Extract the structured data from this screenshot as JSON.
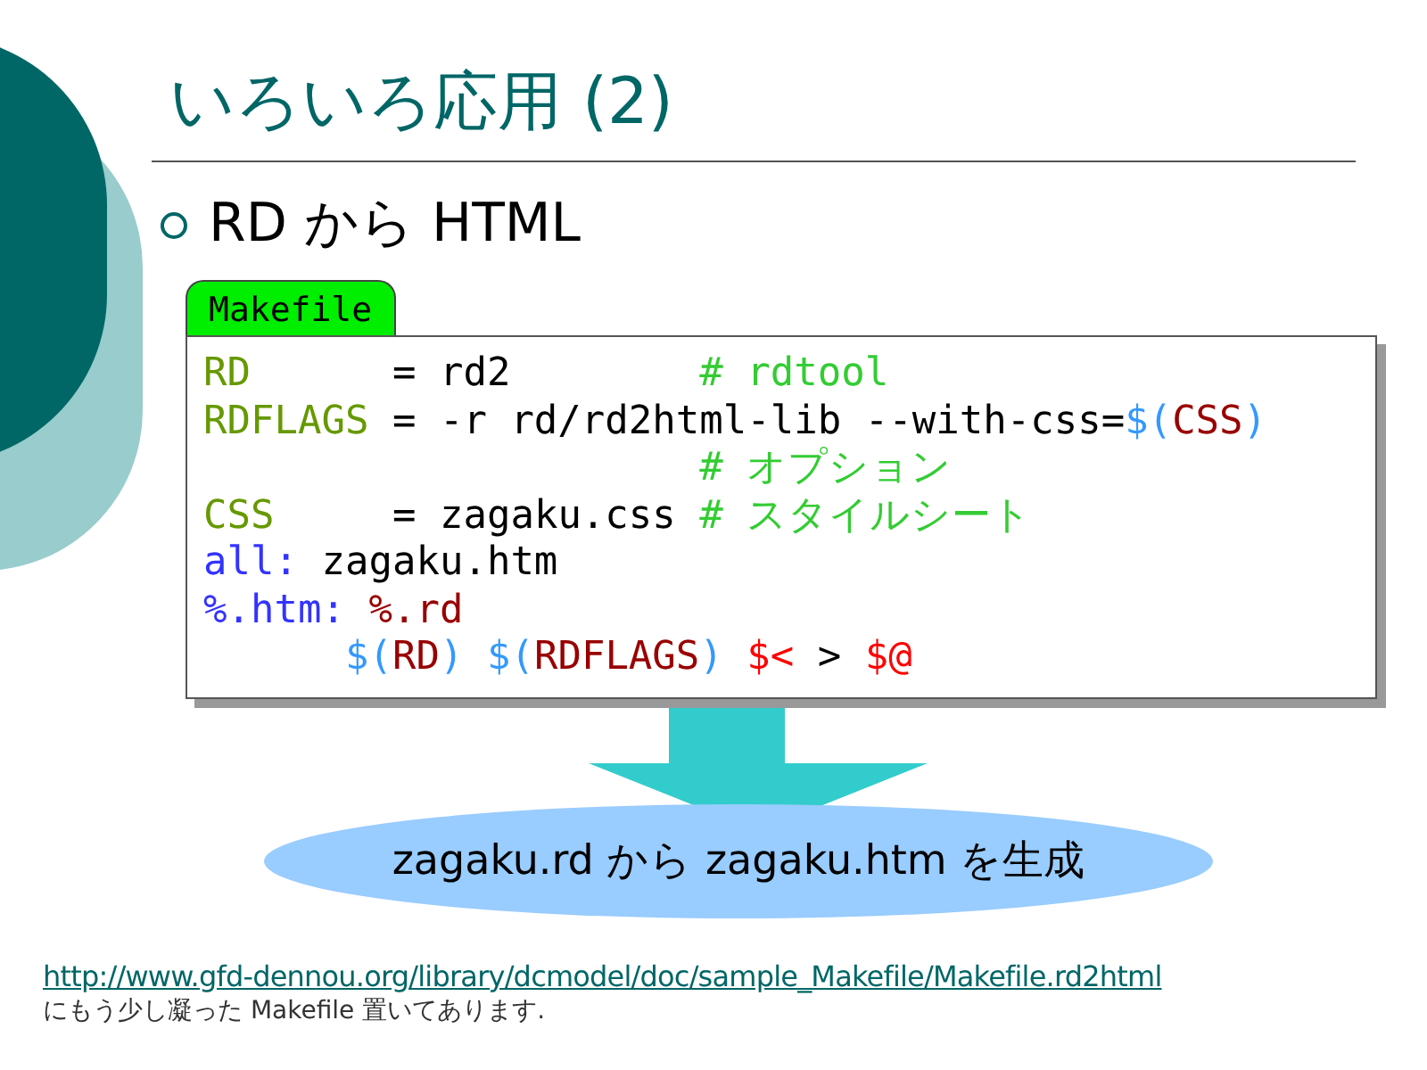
{
  "title": "いろいろ応用 (2)",
  "bullet": "RD から HTML",
  "code_tab": "Makefile",
  "code_lines": [
    [
      {
        "kind": "var",
        "text": "RD"
      },
      {
        "kind": "plain",
        "text": "      = rd2        "
      },
      {
        "kind": "comment",
        "text": "# rdtool"
      }
    ],
    [
      {
        "kind": "var",
        "text": "RDFLAGS"
      },
      {
        "kind": "plain",
        "text": " = -r rd/rd2html-lib --with-css="
      },
      {
        "kind": "dollar",
        "text": "$("
      },
      {
        "kind": "name",
        "text": "CSS"
      },
      {
        "kind": "dollar",
        "text": ")"
      }
    ],
    [
      {
        "kind": "comment",
        "text": "                     # オプション"
      }
    ],
    [
      {
        "kind": "var",
        "text": "CSS"
      },
      {
        "kind": "plain",
        "text": "     = zagaku.css "
      },
      {
        "kind": "comment",
        "text": "# スタイルシート"
      }
    ],
    [
      {
        "kind": "target",
        "text": "all:"
      },
      {
        "kind": "plain",
        "text": " zagaku.htm"
      }
    ],
    [
      {
        "kind": "target",
        "text": "%.htm: "
      },
      {
        "kind": "name",
        "text": "%.rd"
      }
    ],
    [
      {
        "kind": "dollar",
        "text": "      $("
      },
      {
        "kind": "name",
        "text": "RD"
      },
      {
        "kind": "dollar",
        "text": ") $("
      },
      {
        "kind": "name",
        "text": "RDFLAGS"
      },
      {
        "kind": "dollar",
        "text": ") "
      },
      {
        "kind": "special",
        "text": "$<"
      },
      {
        "kind": "plain",
        "text": " > "
      },
      {
        "kind": "special",
        "text": "$@"
      }
    ]
  ],
  "result": "zagaku.rd から zagaku.htm を生成",
  "link": "http://www.gfd-dennou.org/library/dcmodel/doc/sample_Makefile/Makefile.rd2html",
  "note": "にもう少し凝った Makefile 置いてあります."
}
